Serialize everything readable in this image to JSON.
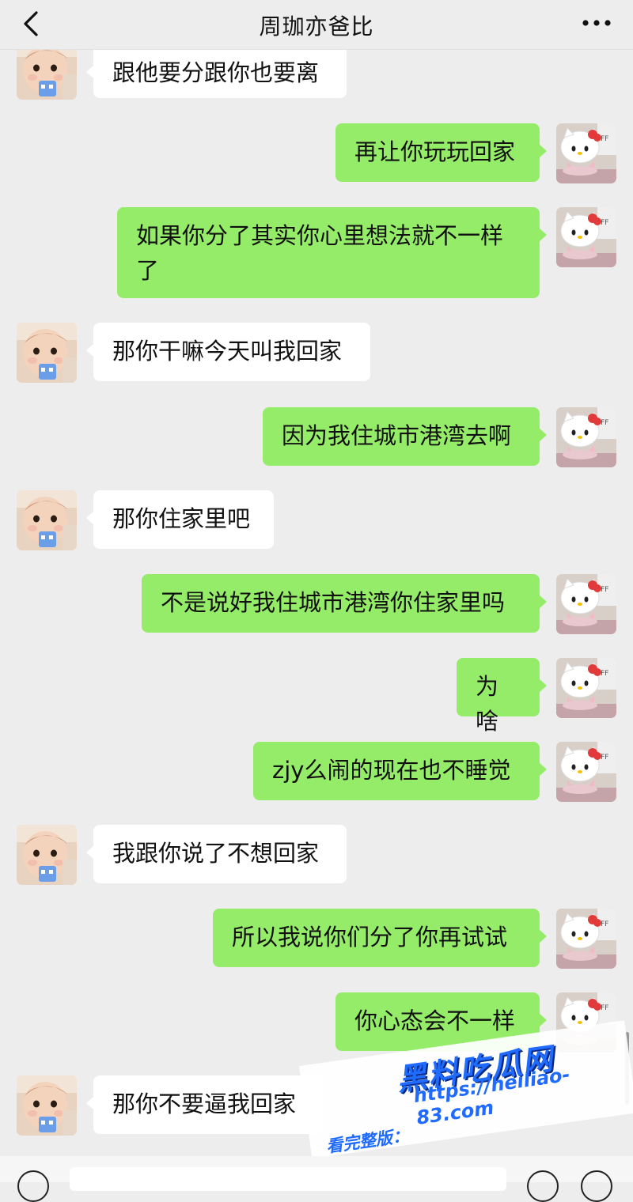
{
  "header": {
    "title": "周珈亦爸比"
  },
  "messages": [
    {
      "side": "left",
      "text": "跟他要分跟你也要离"
    },
    {
      "side": "right",
      "text": "再让你玩玩回家"
    },
    {
      "side": "right",
      "text": "如果你分了其实你心里想法就不一样了"
    },
    {
      "side": "left",
      "text": "那你干嘛今天叫我回家"
    },
    {
      "side": "right",
      "text": "因为我住城市港湾去啊"
    },
    {
      "side": "left",
      "text": "那你住家里吧"
    },
    {
      "side": "right",
      "text": "不是说好我住城市港湾你住家里吗"
    },
    {
      "side": "right",
      "text": "为啥"
    },
    {
      "side": "right",
      "text": "zjy么闹的现在也不睡觉"
    },
    {
      "side": "left",
      "text": "我跟你说了不想回家"
    },
    {
      "side": "right",
      "text": "所以我说你们分了你再试试"
    },
    {
      "side": "right",
      "text": "你心态会不一样"
    },
    {
      "side": "left",
      "text": "那你不要逼我回家"
    }
  ],
  "watermark": {
    "logo": "黑料吃瓜网",
    "prefix": "看完整版：",
    "url": "https://heiliao-83.com"
  },
  "colors": {
    "background": "#ededed",
    "bubble_self": "#95ec69",
    "bubble_other": "#ffffff",
    "watermark": "#1f6bff"
  },
  "icons": {
    "back": "chevron-left-icon",
    "more": "more-dots-icon",
    "avatar_other": "baby-avatar",
    "avatar_self": "hello-kitty-avatar"
  }
}
